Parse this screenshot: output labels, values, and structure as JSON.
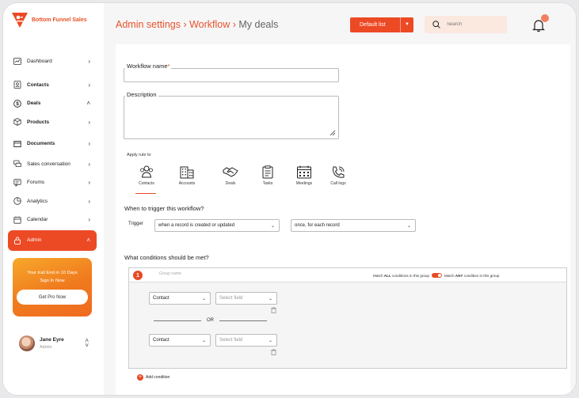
{
  "brand": {
    "name": "Bottom Funnel Sales",
    "accent": "#ec4a25"
  },
  "sidebar": {
    "items": [
      {
        "label": "Dashboard",
        "icon": "chart-icon",
        "chevron": "›"
      },
      {
        "label": "Contacts",
        "icon": "contacts-icon",
        "chevron": "›"
      },
      {
        "label": "Deals",
        "icon": "dollar-icon",
        "chevron": "˄"
      },
      {
        "label": "Products",
        "icon": "box-icon",
        "chevron": "›"
      },
      {
        "label": "Documents",
        "icon": "document-icon",
        "chevron": "›"
      },
      {
        "label": "Sales conversation",
        "icon": "chat-icon",
        "chevron": "›"
      },
      {
        "label": "Forums",
        "icon": "forum-icon",
        "chevron": "›"
      },
      {
        "label": "Analytics",
        "icon": "analytics-icon",
        "chevron": "›"
      },
      {
        "label": "Calendar",
        "icon": "calendar-icon",
        "chevron": "›"
      },
      {
        "label": "Admin",
        "icon": "lock-icon",
        "chevron": "˄"
      }
    ],
    "trial": {
      "line1": "Your trail End in 10 Days",
      "line2": "Sign In Now",
      "button": "Get Pro Now"
    },
    "user": {
      "name": "Jane Eyre",
      "role": "Admin"
    }
  },
  "header": {
    "crumb1": "Admin settings",
    "sep1": " › ",
    "crumb2": "Workflow",
    "sep2": " › ",
    "current": "My deals",
    "default_list": "Default list",
    "search_placeholder": "Search"
  },
  "form": {
    "workflow_name_label": "Workflow name",
    "required_mark": "*",
    "description_label": "Description",
    "apply_rule_label": "Apply rule to",
    "entities": [
      "Contacts",
      "Accounts",
      "Deals",
      "Tasks",
      "Meetings",
      "Call logs"
    ],
    "selected_entity": "Contacts",
    "trigger_title": "When to trigger this workflow?",
    "trigger_label": "Trigger",
    "trigger_value": "when a record is created or updated",
    "frequency_value": "once, for each record",
    "conditions_title": "What conditions should be met?",
    "group": {
      "number": "1",
      "name_placeholder": "Group name",
      "match_all_pre": "Match ",
      "match_all_bold": "ALL",
      "match_all_post": " conditions in this group",
      "match_any_pre": "Match ",
      "match_any_bold": "ANY",
      "match_any_post": " condition in this group",
      "conditions": [
        {
          "object": "Contact",
          "field_placeholder": "Select field"
        },
        {
          "object": "Contact",
          "field_placeholder": "Select field"
        }
      ],
      "or_label": "OR"
    },
    "add_condition": "Add condition"
  }
}
